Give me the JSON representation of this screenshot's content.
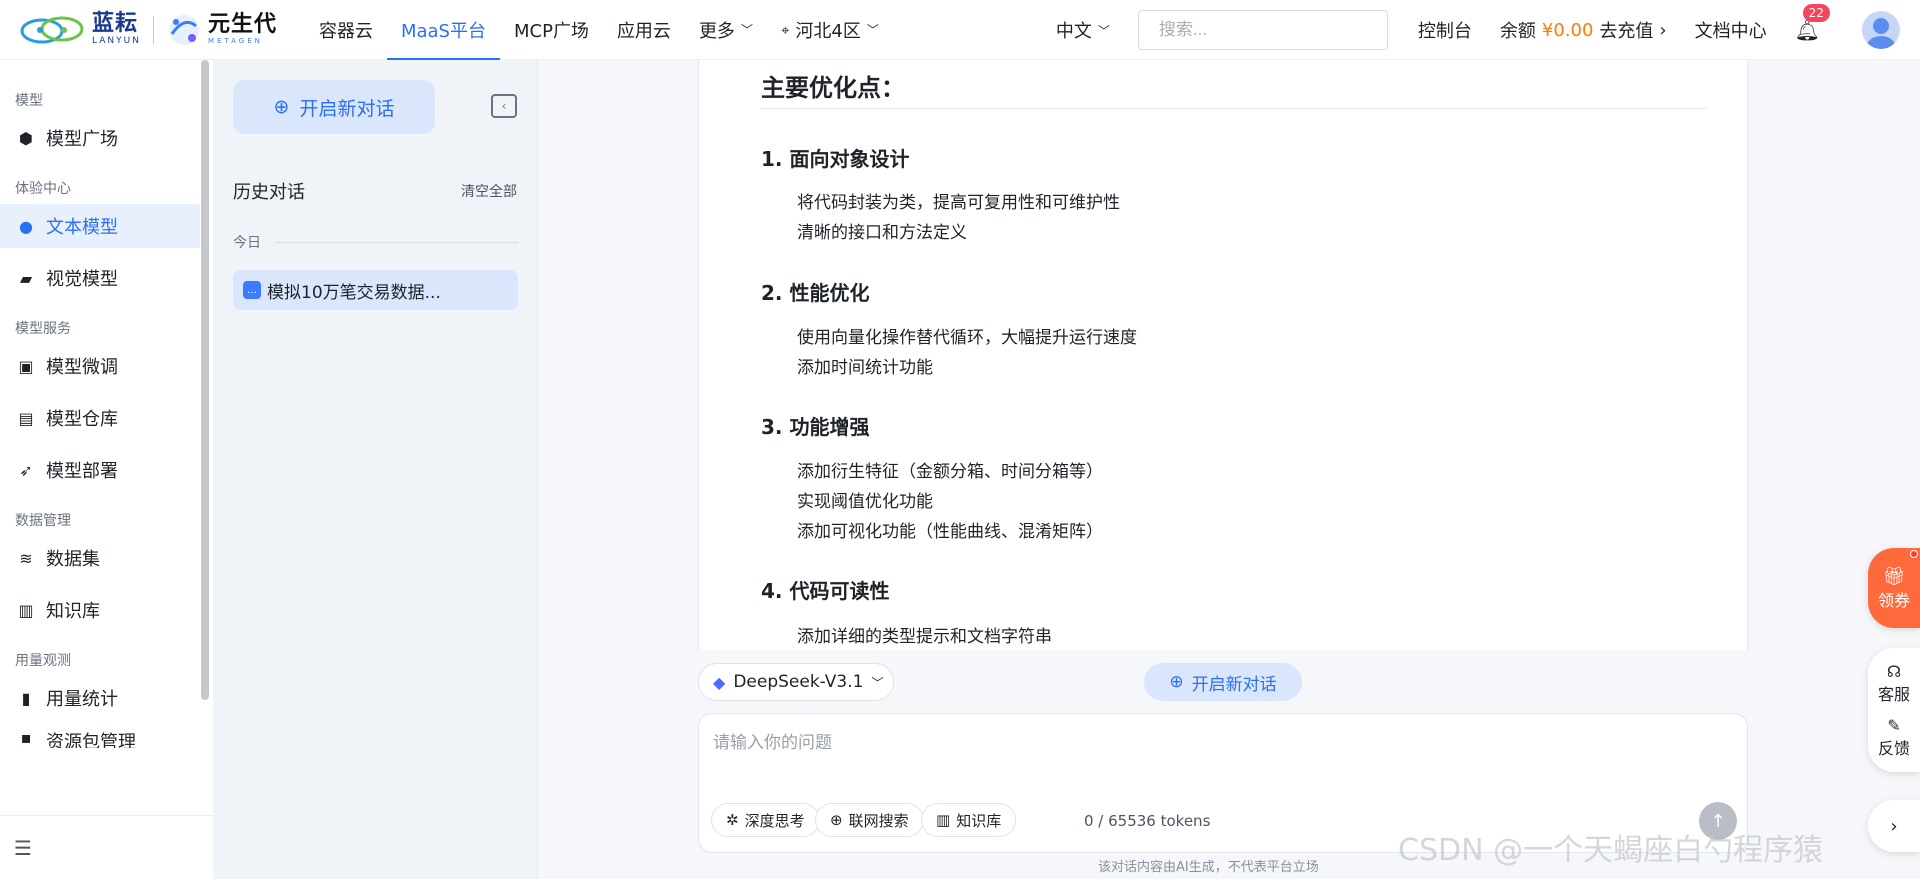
{
  "header": {
    "logo_lanyun_cn": "蓝耘",
    "logo_lanyun_en": "LANYUN",
    "logo_meta_cn": "元生代",
    "logo_meta_en": "METAGEN",
    "nav": [
      {
        "label": "容器云"
      },
      {
        "label": "MaaS平台",
        "active": true
      },
      {
        "label": "MCP广场"
      },
      {
        "label": "应用云"
      },
      {
        "label": "更多"
      }
    ],
    "region": "河北4区",
    "lang": "中文",
    "search_placeholder": "搜索...",
    "console": "控制台",
    "balance_label": "余额",
    "balance_amount": "¥0.00",
    "recharge": "去充值",
    "docs": "文档中心",
    "notification_count": "22"
  },
  "sidebar": {
    "groups": {
      "model": "模型",
      "experience": "体验中心",
      "service": "模型服务",
      "data": "数据管理",
      "usage": "用量观测"
    },
    "items": {
      "model_square": "模型广场",
      "text_model": "文本模型",
      "vision_model": "视觉模型",
      "finetune": "模型微调",
      "repo": "模型仓库",
      "deploy": "模型部署",
      "dataset": "数据集",
      "kb": "知识库",
      "usage_stats": "用量统计",
      "cut_off": "资源包管理"
    }
  },
  "history": {
    "new_chat": "开启新对话",
    "title": "历史对话",
    "clear_all": "清空全部",
    "today": "今日",
    "items": [
      {
        "title": "模拟10万笔交易数据..."
      }
    ]
  },
  "answer": {
    "heading": "主要优化点：",
    "sections": [
      {
        "title": "1. 面向对象设计",
        "bullets": [
          "将代码封装为类，提高可复用性和可维护性",
          "清晰的接口和方法定义"
        ]
      },
      {
        "title": "2. 性能优化",
        "bullets": [
          "使用向量化操作替代循环，大幅提升运行速度",
          "添加时间统计功能"
        ]
      },
      {
        "title": "3. 功能增强",
        "bullets": [
          "添加衍生特征（金额分箱、时间分箱等）",
          "实现阈值优化功能",
          "添加可视化功能（性能曲线、混淆矩阵）"
        ]
      },
      {
        "title": "4. 代码可读性",
        "bullets": [
          "添加详细的类型提示和文档字符串"
        ]
      }
    ]
  },
  "composer": {
    "model": "DeepSeek-V3.1",
    "new_chat": "开启新对话",
    "placeholder": "请输入你的问题",
    "deep_think": "深度思考",
    "web_search": "联网搜索",
    "kb": "知识库",
    "tokens": "0 / 65536 tokens",
    "disclaimer": "该对话内容由AI生成，不代表平台立场"
  },
  "floating": {
    "coupon": "领券",
    "service": "客服",
    "feedback": "反馈"
  },
  "watermark": "CSDN @一个天蝎座白勺程序猿",
  "colors": {
    "accent": "#2b6ff5",
    "coupon": "#ff6a3d",
    "badge": "#f5455c",
    "balance": "#ff7a00"
  }
}
